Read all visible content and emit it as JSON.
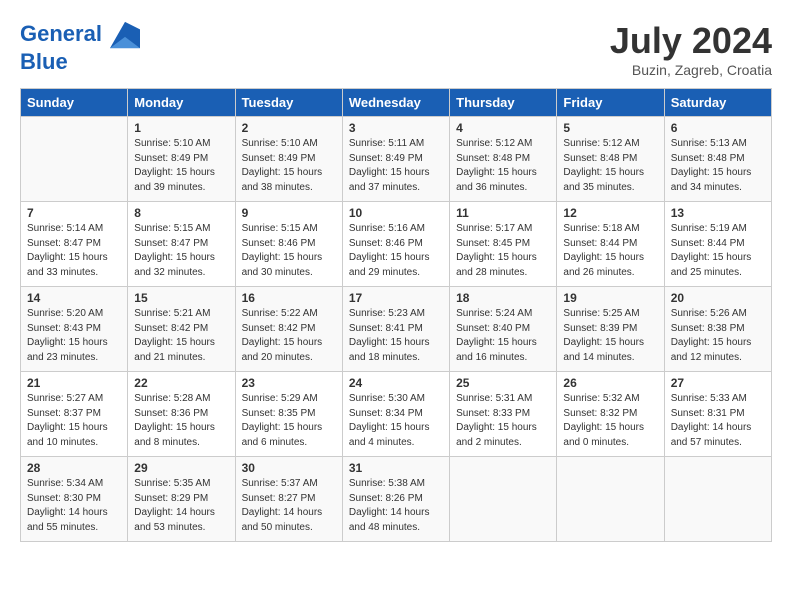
{
  "logo": {
    "line1": "General",
    "line2": "Blue"
  },
  "title": "July 2024",
  "subtitle": "Buzin, Zagreb, Croatia",
  "weekdays": [
    "Sunday",
    "Monday",
    "Tuesday",
    "Wednesday",
    "Thursday",
    "Friday",
    "Saturday"
  ],
  "weeks": [
    [
      {
        "num": "",
        "info": ""
      },
      {
        "num": "1",
        "info": "Sunrise: 5:10 AM\nSunset: 8:49 PM\nDaylight: 15 hours\nand 39 minutes."
      },
      {
        "num": "2",
        "info": "Sunrise: 5:10 AM\nSunset: 8:49 PM\nDaylight: 15 hours\nand 38 minutes."
      },
      {
        "num": "3",
        "info": "Sunrise: 5:11 AM\nSunset: 8:49 PM\nDaylight: 15 hours\nand 37 minutes."
      },
      {
        "num": "4",
        "info": "Sunrise: 5:12 AM\nSunset: 8:48 PM\nDaylight: 15 hours\nand 36 minutes."
      },
      {
        "num": "5",
        "info": "Sunrise: 5:12 AM\nSunset: 8:48 PM\nDaylight: 15 hours\nand 35 minutes."
      },
      {
        "num": "6",
        "info": "Sunrise: 5:13 AM\nSunset: 8:48 PM\nDaylight: 15 hours\nand 34 minutes."
      }
    ],
    [
      {
        "num": "7",
        "info": "Sunrise: 5:14 AM\nSunset: 8:47 PM\nDaylight: 15 hours\nand 33 minutes."
      },
      {
        "num": "8",
        "info": "Sunrise: 5:15 AM\nSunset: 8:47 PM\nDaylight: 15 hours\nand 32 minutes."
      },
      {
        "num": "9",
        "info": "Sunrise: 5:15 AM\nSunset: 8:46 PM\nDaylight: 15 hours\nand 30 minutes."
      },
      {
        "num": "10",
        "info": "Sunrise: 5:16 AM\nSunset: 8:46 PM\nDaylight: 15 hours\nand 29 minutes."
      },
      {
        "num": "11",
        "info": "Sunrise: 5:17 AM\nSunset: 8:45 PM\nDaylight: 15 hours\nand 28 minutes."
      },
      {
        "num": "12",
        "info": "Sunrise: 5:18 AM\nSunset: 8:44 PM\nDaylight: 15 hours\nand 26 minutes."
      },
      {
        "num": "13",
        "info": "Sunrise: 5:19 AM\nSunset: 8:44 PM\nDaylight: 15 hours\nand 25 minutes."
      }
    ],
    [
      {
        "num": "14",
        "info": "Sunrise: 5:20 AM\nSunset: 8:43 PM\nDaylight: 15 hours\nand 23 minutes."
      },
      {
        "num": "15",
        "info": "Sunrise: 5:21 AM\nSunset: 8:42 PM\nDaylight: 15 hours\nand 21 minutes."
      },
      {
        "num": "16",
        "info": "Sunrise: 5:22 AM\nSunset: 8:42 PM\nDaylight: 15 hours\nand 20 minutes."
      },
      {
        "num": "17",
        "info": "Sunrise: 5:23 AM\nSunset: 8:41 PM\nDaylight: 15 hours\nand 18 minutes."
      },
      {
        "num": "18",
        "info": "Sunrise: 5:24 AM\nSunset: 8:40 PM\nDaylight: 15 hours\nand 16 minutes."
      },
      {
        "num": "19",
        "info": "Sunrise: 5:25 AM\nSunset: 8:39 PM\nDaylight: 15 hours\nand 14 minutes."
      },
      {
        "num": "20",
        "info": "Sunrise: 5:26 AM\nSunset: 8:38 PM\nDaylight: 15 hours\nand 12 minutes."
      }
    ],
    [
      {
        "num": "21",
        "info": "Sunrise: 5:27 AM\nSunset: 8:37 PM\nDaylight: 15 hours\nand 10 minutes."
      },
      {
        "num": "22",
        "info": "Sunrise: 5:28 AM\nSunset: 8:36 PM\nDaylight: 15 hours\nand 8 minutes."
      },
      {
        "num": "23",
        "info": "Sunrise: 5:29 AM\nSunset: 8:35 PM\nDaylight: 15 hours\nand 6 minutes."
      },
      {
        "num": "24",
        "info": "Sunrise: 5:30 AM\nSunset: 8:34 PM\nDaylight: 15 hours\nand 4 minutes."
      },
      {
        "num": "25",
        "info": "Sunrise: 5:31 AM\nSunset: 8:33 PM\nDaylight: 15 hours\nand 2 minutes."
      },
      {
        "num": "26",
        "info": "Sunrise: 5:32 AM\nSunset: 8:32 PM\nDaylight: 15 hours\nand 0 minutes."
      },
      {
        "num": "27",
        "info": "Sunrise: 5:33 AM\nSunset: 8:31 PM\nDaylight: 14 hours\nand 57 minutes."
      }
    ],
    [
      {
        "num": "28",
        "info": "Sunrise: 5:34 AM\nSunset: 8:30 PM\nDaylight: 14 hours\nand 55 minutes."
      },
      {
        "num": "29",
        "info": "Sunrise: 5:35 AM\nSunset: 8:29 PM\nDaylight: 14 hours\nand 53 minutes."
      },
      {
        "num": "30",
        "info": "Sunrise: 5:37 AM\nSunset: 8:27 PM\nDaylight: 14 hours\nand 50 minutes."
      },
      {
        "num": "31",
        "info": "Sunrise: 5:38 AM\nSunset: 8:26 PM\nDaylight: 14 hours\nand 48 minutes."
      },
      {
        "num": "",
        "info": ""
      },
      {
        "num": "",
        "info": ""
      },
      {
        "num": "",
        "info": ""
      }
    ]
  ]
}
